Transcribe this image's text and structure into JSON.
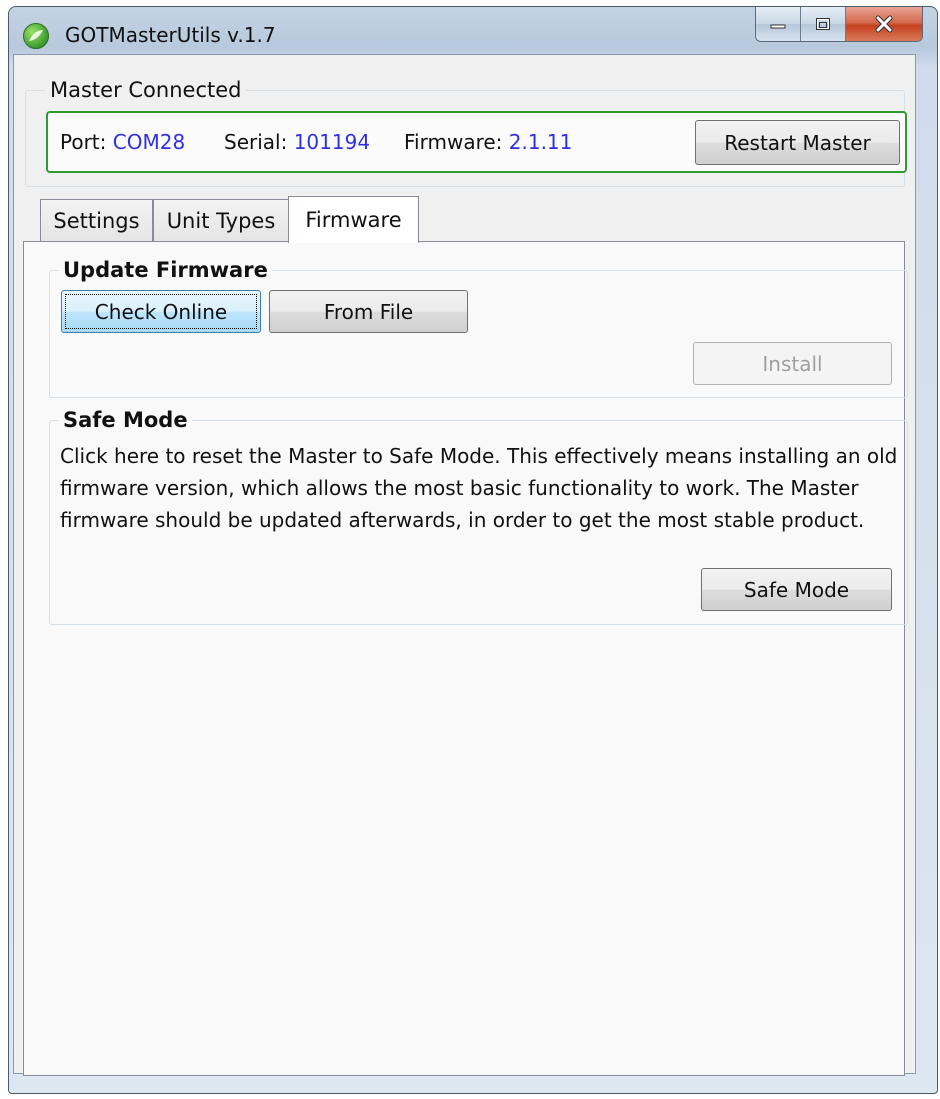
{
  "window": {
    "title": "GOTMasterUtils v.1.7",
    "controls": [
      "minimize-icon",
      "maximize-icon",
      "close-icon"
    ]
  },
  "connection": {
    "group_label": "Master Connected",
    "port_label": "Port:",
    "port_value": "COM28",
    "serial_label": "Serial:",
    "serial_value": "101194",
    "firmware_label": "Firmware:",
    "firmware_value": "2.1.11",
    "restart_button": "Restart Master",
    "border_color": "#2f9a2f",
    "value_color": "#2f2fe6"
  },
  "tabs": [
    {
      "label": "Settings",
      "selected": false
    },
    {
      "label": "Unit Types",
      "selected": false
    },
    {
      "label": "Firmware",
      "selected": true
    }
  ],
  "update_firmware": {
    "title": "Update Firmware",
    "check_online_button": "Check Online",
    "from_file_button": "From File",
    "install_button": "Install"
  },
  "safe_mode": {
    "title": "Safe Mode",
    "description": "Click here to reset the Master to Safe Mode. This effectively means installing an old firmware version, which allows the most basic functionality to work. The Master firmware should be updated afterwards, in order to get the most stable product.",
    "button": "Safe Mode"
  }
}
